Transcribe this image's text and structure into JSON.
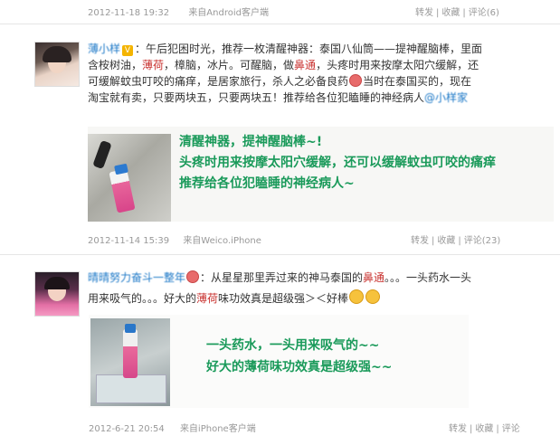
{
  "post0": {
    "time": "2012-11-18 19:32",
    "source": "来自Android客户端",
    "actions": [
      "转发",
      "收藏",
      "评论(6)"
    ]
  },
  "post1": {
    "username": "薄小样",
    "text_l1a": "：午后犯困时光，推荐一枚清醒神器：泰国八仙筒——提神醒脑棒，里面",
    "text_l2a": "含桉树油，",
    "text_l2b": "薄荷",
    "text_l2c": "，樟脑，冰片。可醒脑，做",
    "text_l2d": "鼻通",
    "text_l2e": "，头疼时用来按摩太阳穴缓解，还",
    "text_l3a": "可缓解蚊虫叮咬的痛痒，是居家旅行，杀人之必备良药",
    "text_l3b": "当时在泰国买的，现在",
    "text_l4a": "淘宝就有卖，只要两块五，只要两块五！推荐给各位犯瞌睡的神经病人",
    "mention": "@小样家",
    "image_lines": [
      "清醒神器，提神醒脑棒~!",
      "头疼时用来按摩太阳穴缓解，还可以缓解蚊虫叮咬的痛痒",
      "推荐给各位犯瞌睡的神经病人~"
    ],
    "time": "2012-11-14 15:39",
    "source": "来自Weico.iPhone",
    "actions": [
      "转发",
      "收藏",
      "评论(23)"
    ]
  },
  "post2": {
    "username": "晴晴努力奋斗一整年",
    "text_l1a": "：从星星那里弄过来的神马泰国的",
    "text_l1b": "鼻通",
    "text_l1c": "。。。一头药水一头",
    "text_l2a": "用来吸气的。。。好大的",
    "text_l2b": "薄荷",
    "text_l2c": "味功效真是超级强＞＜好棒",
    "image_lines": [
      "一头药水，一头用来吸气的~~",
      "好大的薄荷味功效真是超级强~~"
    ],
    "time": "2012-6-21 20:54",
    "source": "来自iPhone客户端",
    "actions": [
      "转发",
      "收藏",
      "评论"
    ]
  },
  "colors": {
    "highlight": "#c93330",
    "link": "#1c78c7",
    "image_text": "#1a9a5a",
    "meta": "#999999"
  }
}
